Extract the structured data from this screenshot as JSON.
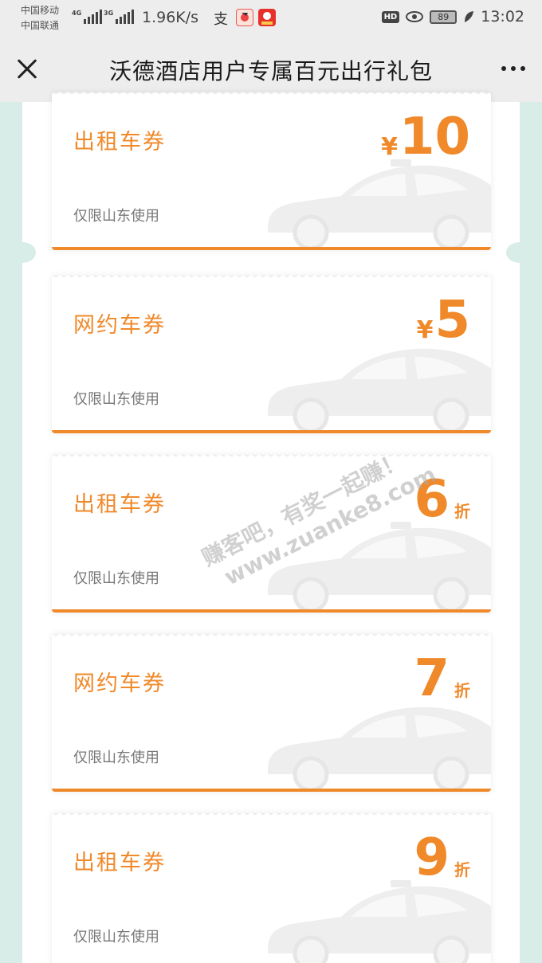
{
  "status_bar": {
    "carrier_1": "中国移动",
    "carrier_2": "中国联通",
    "net_1": "4G",
    "net_2": "3G",
    "speed": "1.96K/s",
    "battery": "89",
    "time": "13:02",
    "hd_label": "HD"
  },
  "navbar": {
    "title": "沃德酒店用户专属百元出行礼包"
  },
  "colors": {
    "accent": "#f0892a",
    "page_bg": "#d8ece8"
  },
  "coupons": [
    {
      "name": "出租车券",
      "currency": "¥",
      "value": "10",
      "unit": "",
      "region": "仅限山东使用",
      "car": "taxi"
    },
    {
      "name": "网约车券",
      "currency": "¥",
      "value": "5",
      "unit": "",
      "region": "仅限山东使用",
      "car": "sedan"
    },
    {
      "name": "出租车券",
      "currency": "",
      "value": "6",
      "unit": "折",
      "region": "仅限山东使用",
      "car": "taxi"
    },
    {
      "name": "网约车券",
      "currency": "",
      "value": "7",
      "unit": "折",
      "region": "仅限山东使用",
      "car": "sedan"
    },
    {
      "name": "出租车券",
      "currency": "",
      "value": "9",
      "unit": "折",
      "region": "仅限山东使用",
      "car": "taxi"
    }
  ],
  "watermark": {
    "line1": "赚客吧，有奖一起赚！",
    "line2": "www.zuanke8.com"
  }
}
